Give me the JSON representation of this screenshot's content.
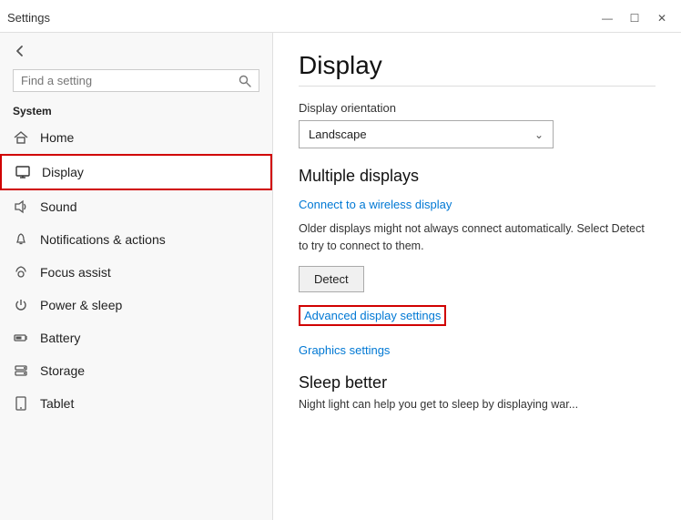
{
  "titlebar": {
    "title": "Settings",
    "back_icon": "←",
    "min_btn": "—",
    "max_btn": "☐",
    "close_btn": "✕"
  },
  "sidebar": {
    "search_placeholder": "Find a setting",
    "search_icon": "🔍",
    "section_label": "System",
    "items": [
      {
        "id": "home",
        "label": "Home",
        "icon": "home"
      },
      {
        "id": "display",
        "label": "Display",
        "icon": "display",
        "active": true
      },
      {
        "id": "sound",
        "label": "Sound",
        "icon": "sound"
      },
      {
        "id": "notifications",
        "label": "Notifications & actions",
        "icon": "notifications"
      },
      {
        "id": "focus",
        "label": "Focus assist",
        "icon": "focus"
      },
      {
        "id": "power",
        "label": "Power & sleep",
        "icon": "power"
      },
      {
        "id": "battery",
        "label": "Battery",
        "icon": "battery"
      },
      {
        "id": "storage",
        "label": "Storage",
        "icon": "storage"
      },
      {
        "id": "tablet",
        "label": "Tablet",
        "icon": "tablet"
      }
    ]
  },
  "main": {
    "title": "Display",
    "orientation_label": "Display orientation",
    "orientation_value": "Landscape",
    "multiple_displays_title": "Multiple displays",
    "connect_wireless_link": "Connect to a wireless display",
    "older_displays_info": "Older displays might not always connect automatically. Select Detect to try to connect to them.",
    "detect_btn": "Detect",
    "advanced_settings_link": "Advanced display settings",
    "graphics_settings_link": "Graphics settings",
    "sleep_title": "Sleep better",
    "sleep_info": "Night light can help you get to sleep by displaying war..."
  }
}
